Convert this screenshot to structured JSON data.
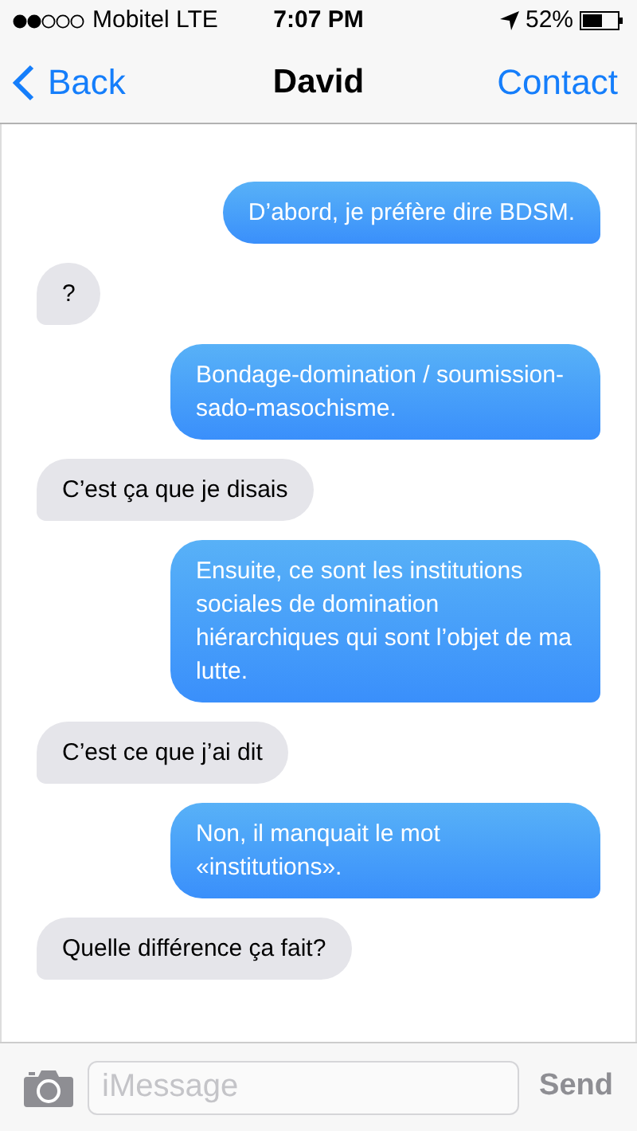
{
  "status_bar": {
    "carrier": "Mobitel LTE",
    "time": "7:07 PM",
    "battery": "52%"
  },
  "nav": {
    "back": "Back",
    "title": "David",
    "action": "Contact"
  },
  "messages": [
    {
      "kind": "sent",
      "text": "D’abord, je préfère dire BDSM."
    },
    {
      "kind": "received",
      "text": "?"
    },
    {
      "kind": "sent",
      "text": "Bondage-domination / soumission-sado-masochisme."
    },
    {
      "kind": "received",
      "text": "C’est ça que je disais"
    },
    {
      "kind": "sent",
      "text": "Ensuite, ce sont les institutions sociales de domination hiérarchiques qui sont l’objet de ma lutte."
    },
    {
      "kind": "received",
      "text": "C’est ce que j’ai dit"
    },
    {
      "kind": "sent",
      "text": "Non, il manquait le mot «institutions»."
    },
    {
      "kind": "received",
      "text": "Quelle différence ça fait?"
    }
  ],
  "composer": {
    "placeholder": "iMessage",
    "send": "Send",
    "send_disabled": true
  }
}
